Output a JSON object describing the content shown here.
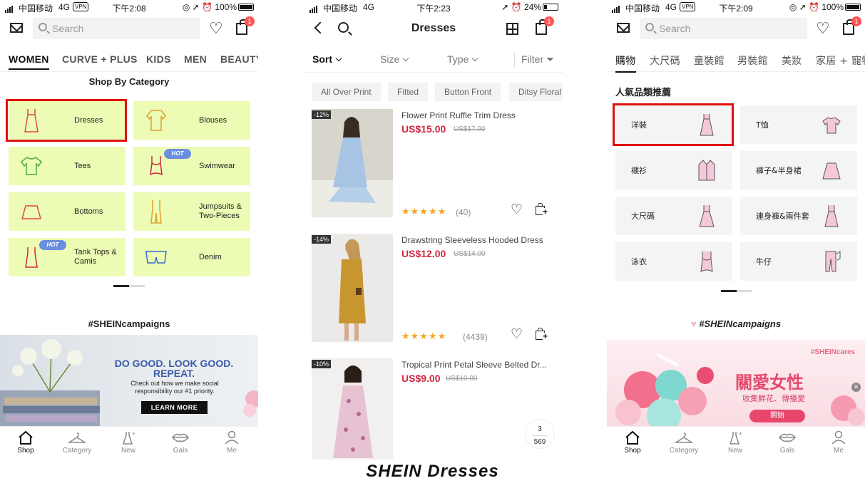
{
  "caption": "SHEIN Dresses",
  "status_bars": [
    {
      "carrier": "中国移动",
      "network": "4G",
      "vpn": "VPN",
      "time": "下午2:08",
      "battery": "100%",
      "battery_level": 1.0
    },
    {
      "carrier": "中国移动",
      "network": "4G",
      "vpn": "",
      "time": "下午2:23",
      "battery": "24%",
      "battery_level": 0.24
    },
    {
      "carrier": "中国移动",
      "network": "4G",
      "vpn": "VPN",
      "time": "下午2:09",
      "battery": "100%",
      "battery_level": 1.0
    }
  ],
  "shop_en": {
    "search_placeholder": "Search",
    "cart_badge": "1",
    "tabs": [
      "WOMEN",
      "CURVE + PLUS",
      "KIDS",
      "MEN",
      "BEAUTY"
    ],
    "section_title": "Shop By Category",
    "categories": [
      {
        "label": "Dresses",
        "icon": "dress-icon",
        "hot": false,
        "highlighted": true
      },
      {
        "label": "Blouses",
        "icon": "blouse-icon",
        "hot": false
      },
      {
        "label": "Tees",
        "icon": "tee-icon",
        "hot": false
      },
      {
        "label": "Swimwear",
        "icon": "swimsuit-icon",
        "hot": true
      },
      {
        "label": "Bottoms",
        "icon": "skirt-icon",
        "hot": false
      },
      {
        "label": "Jumpsuits & Two-Pieces",
        "icon": "jumpsuit-icon",
        "hot": false
      },
      {
        "label": "Tank Tops & Camis",
        "icon": "tank-top-icon",
        "hot": true
      },
      {
        "label": "Denim",
        "icon": "shorts-icon",
        "hot": false
      }
    ],
    "hot_label": "HOT",
    "campaign_title": "#SHEINcampaigns",
    "banner": {
      "headline": "DO GOOD. LOOK GOOD. REPEAT.",
      "text": "Check out how we make social responsibility our #1 priority.",
      "button": "LEARN MORE"
    },
    "nav": [
      "Shop",
      "Category",
      "New",
      "Gals",
      "Me"
    ]
  },
  "dresses": {
    "title": "Dresses",
    "cart_badge": "1",
    "filters": [
      "Sort",
      "Size",
      "Type",
      "Filter"
    ],
    "chips": [
      "All Over Print",
      "Fitted",
      "Button Front",
      "Ditsy Floral"
    ],
    "products": [
      {
        "name": "Flower Print Ruffle Trim Dress",
        "price": "US$15.00",
        "old_price": "US$17.00",
        "discount": "-12%",
        "rating": 4.5,
        "reviews": "(40)"
      },
      {
        "name": "Drawstring Sleeveless Hooded Dress",
        "price": "US$12.00",
        "old_price": "US$14.00",
        "discount": "-14%",
        "rating": 4.5,
        "reviews": "(4439)"
      },
      {
        "name": "Tropical Print Petal Sleeve Belted Dr...",
        "price": "US$9.00",
        "old_price": "US$10.00",
        "discount": "-10%",
        "rating": 4.5,
        "reviews": ""
      }
    ],
    "pager_current": "3",
    "pager_total": "569"
  },
  "shop_zh": {
    "search_placeholder": "Search",
    "cart_badge": "1",
    "tabs": [
      "購物",
      "大尺碼",
      "童裝館",
      "男裝館",
      "美妝",
      "家居 + 寵物"
    ],
    "section_title": "人氣品類推薦",
    "categories": [
      {
        "label": "洋裝",
        "icon": "dress-icon",
        "highlighted": true
      },
      {
        "label": "T恤",
        "icon": "tee-icon"
      },
      {
        "label": "襯衫",
        "icon": "shirt-icon"
      },
      {
        "label": "褲子&半身裙",
        "icon": "skirt-icon"
      },
      {
        "label": "大尺碼",
        "icon": "dress-icon"
      },
      {
        "label": "連身褲&兩件套",
        "icon": "dress-icon"
      },
      {
        "label": "泳衣",
        "icon": "swimsuit-icon"
      },
      {
        "label": "牛仔",
        "icon": "jeans-icon"
      }
    ],
    "campaign_title": "#SHEINcampaigns",
    "banner": {
      "tag": "#SHEINcares",
      "headline": "關愛女性",
      "text": "收集鮮花、傳播愛",
      "button": "開始"
    },
    "nav": [
      "Shop",
      "Category",
      "New",
      "Gals",
      "Me"
    ]
  },
  "colors": {
    "tile_green": "#ecfcb4",
    "highlight_red": "#e01010",
    "price_red": "#d02840",
    "hot_blue": "#6a8fe0"
  }
}
